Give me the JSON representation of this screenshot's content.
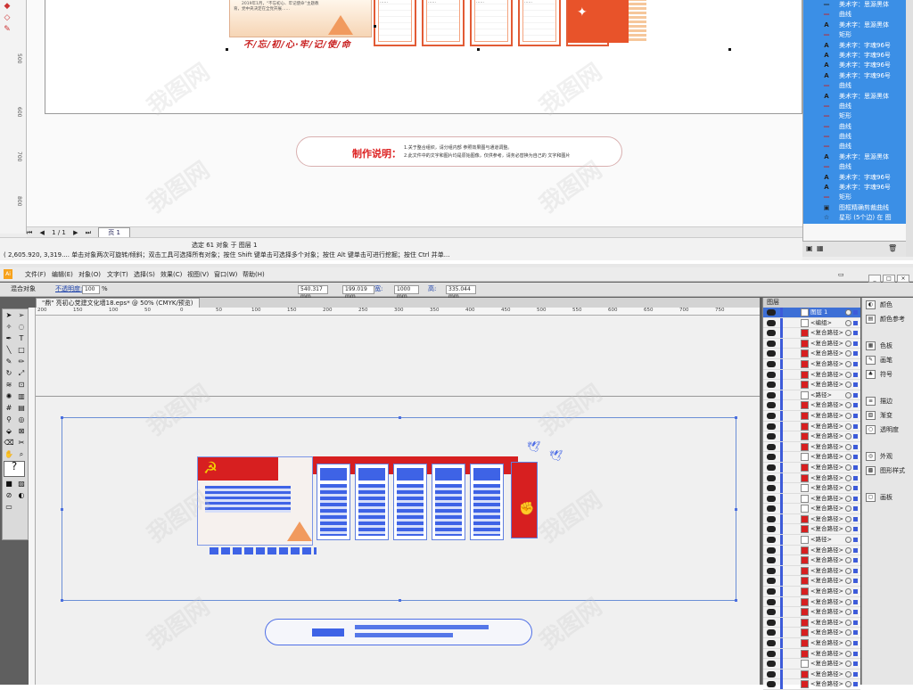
{
  "corel": {
    "ruler_v_labels": [
      "500",
      "600",
      "700",
      "800"
    ],
    "slogan": "不/忘/初/心·牢/记/使/命",
    "note_label": "制作说明：",
    "note_line1": "1.关于整合组织，请分组内部 参照效果图与通道调整。",
    "note_line2": "2.此文件中的文字和图片均是原始图像，仅供参考，请务必替换为自己的 文字和图片",
    "pagebar": {
      "page_count": "1 / 1",
      "page_tab": "页 1"
    },
    "status_line1": "选定 61 对象 于 图层 1",
    "status_line2": "( 2,605.920, 3,319.... 单击对象两次可旋转/倾斜；双击工具可选择所有对象；按住 Shift 键单击可选择多个对象；按住 Alt 键单击可进行挖掘；按住 Ctrl 并单...",
    "object_manager": [
      {
        "icon": "—",
        "label": "美术字：思源黑体",
        "sel": true,
        "red": false
      },
      {
        "icon": "—",
        "label": "曲线",
        "sel": true,
        "red": true
      },
      {
        "icon": "A",
        "label": "美术字：思源黑体",
        "sel": true,
        "red": false
      },
      {
        "icon": "—",
        "label": "矩形",
        "sel": true,
        "red": true
      },
      {
        "icon": "A",
        "label": "美术字：字魂96号",
        "sel": true,
        "red": false
      },
      {
        "icon": "A",
        "label": "美术字：字魂96号",
        "sel": true,
        "red": false
      },
      {
        "icon": "A",
        "label": "美术字：字魂96号",
        "sel": true,
        "red": false
      },
      {
        "icon": "A",
        "label": "美术字：字魂96号",
        "sel": true,
        "red": false
      },
      {
        "icon": "—",
        "label": "曲线",
        "sel": true,
        "red": true
      },
      {
        "icon": "A",
        "label": "美术字：思源黑体",
        "sel": true,
        "red": false
      },
      {
        "icon": "—",
        "label": "曲线",
        "sel": true,
        "red": true
      },
      {
        "icon": "—",
        "label": "矩形",
        "sel": true,
        "red": true
      },
      {
        "icon": "—",
        "label": "曲线",
        "sel": true,
        "red": true
      },
      {
        "icon": "—",
        "label": "曲线",
        "sel": true,
        "red": true
      },
      {
        "icon": "—",
        "label": "曲线",
        "sel": true,
        "red": true
      },
      {
        "icon": "A",
        "label": "美术字：思源黑体",
        "sel": true,
        "red": false
      },
      {
        "icon": "—",
        "label": "曲线",
        "sel": true,
        "red": true
      },
      {
        "icon": "A",
        "label": "美术字：字魂96号",
        "sel": true,
        "red": false
      },
      {
        "icon": "A",
        "label": "美术字：字魂96号",
        "sel": true,
        "red": false
      },
      {
        "icon": "—",
        "label": "矩形",
        "sel": true,
        "red": true
      },
      {
        "icon": "▣",
        "label": "图框精确剪裁曲线",
        "sel": true,
        "red": false
      },
      {
        "icon": "☆",
        "label": "星形 (5个边) 在 图",
        "sel": true,
        "red": false
      }
    ]
  },
  "ai": {
    "menu": [
      "文件(F)",
      "编辑(E)",
      "对象(O)",
      "文字(T)",
      "选择(S)",
      "效果(C)",
      "视图(V)",
      "窗口(W)",
      "帮助(H)"
    ],
    "control": {
      "label": "混合对象",
      "opacity_label": "不透明度:",
      "opacity_value": "100",
      "opacity_unit": "%",
      "x_value": "540.317 mm",
      "y_value": "199.019 mm",
      "w_label": "宽:",
      "w_value": "1000 mm",
      "h_label": "高:",
      "h_value": "335.044 mm"
    },
    "doc_tab": "\"鼎\" 亮初心党建文化墙18.eps* @ 50% (CMYK/预览)",
    "ruler_labels": [
      "200",
      "150",
      "100",
      "50",
      "0",
      "50",
      "100",
      "150",
      "200",
      "250",
      "300",
      "350",
      "400",
      "450",
      "500",
      "550",
      "600",
      "650",
      "700",
      "750"
    ],
    "layers_title": "图层",
    "layers": [
      {
        "label": "图层 1",
        "top": true,
        "red": false
      },
      {
        "label": "<编组>",
        "red": false
      },
      {
        "label": "<复合路径>",
        "red": true
      },
      {
        "label": "<复合路径>",
        "red": true
      },
      {
        "label": "<复合路径>",
        "red": true
      },
      {
        "label": "<复合路径>",
        "red": true
      },
      {
        "label": "<复合路径>",
        "red": true
      },
      {
        "label": "<复合路径>",
        "red": true
      },
      {
        "label": "<路径>",
        "red": false
      },
      {
        "label": "<复合路径>",
        "red": true
      },
      {
        "label": "<复合路径>",
        "red": true
      },
      {
        "label": "<复合路径>",
        "red": true
      },
      {
        "label": "<复合路径>",
        "red": true
      },
      {
        "label": "<复合路径>",
        "red": true
      },
      {
        "label": "<复合路径>",
        "red": false
      },
      {
        "label": "<复合路径>",
        "red": true
      },
      {
        "label": "<复合路径>",
        "red": true
      },
      {
        "label": "<复合路径>",
        "red": false
      },
      {
        "label": "<复合路径>",
        "red": false
      },
      {
        "label": "<复合路径>",
        "red": false
      },
      {
        "label": "<复合路径>",
        "red": true
      },
      {
        "label": "<复合路径>",
        "red": true
      },
      {
        "label": "<路径>",
        "red": false
      },
      {
        "label": "<复合路径>",
        "red": true
      },
      {
        "label": "<复合路径>",
        "red": true
      },
      {
        "label": "<复合路径>",
        "red": true
      },
      {
        "label": "<复合路径>",
        "red": true
      },
      {
        "label": "<复合路径>",
        "red": true
      },
      {
        "label": "<复合路径>",
        "red": true
      },
      {
        "label": "<复合路径>",
        "red": true
      },
      {
        "label": "<复合路径>",
        "red": true
      },
      {
        "label": "<复合路径>",
        "red": true
      },
      {
        "label": "<复合路径>",
        "red": true
      },
      {
        "label": "<复合路径>",
        "red": true
      },
      {
        "label": "<复合路径>",
        "red": false
      },
      {
        "label": "<复合路径>",
        "red": true
      },
      {
        "label": "<复合路径>",
        "red": true
      }
    ],
    "side_panels": [
      {
        "icon": "◐",
        "label": "颜色"
      },
      {
        "icon": "▤",
        "label": "颜色参考"
      },
      {
        "icon": "▦",
        "label": "色板"
      },
      {
        "icon": "✎",
        "label": "画笔"
      },
      {
        "icon": "♣",
        "label": "符号"
      },
      {
        "icon": "≡",
        "label": "描边"
      },
      {
        "icon": "▧",
        "label": "渐变"
      },
      {
        "icon": "○",
        "label": "透明度"
      },
      {
        "icon": "◎",
        "label": "外观"
      },
      {
        "icon": "▩",
        "label": "图形样式"
      },
      {
        "icon": "▢",
        "label": "画板"
      }
    ]
  },
  "watermark": "我图网",
  "colors": {
    "accent_red": "#d71f20",
    "selection_blue": "#3b8fe6",
    "ai_blue": "#3e63e6"
  }
}
